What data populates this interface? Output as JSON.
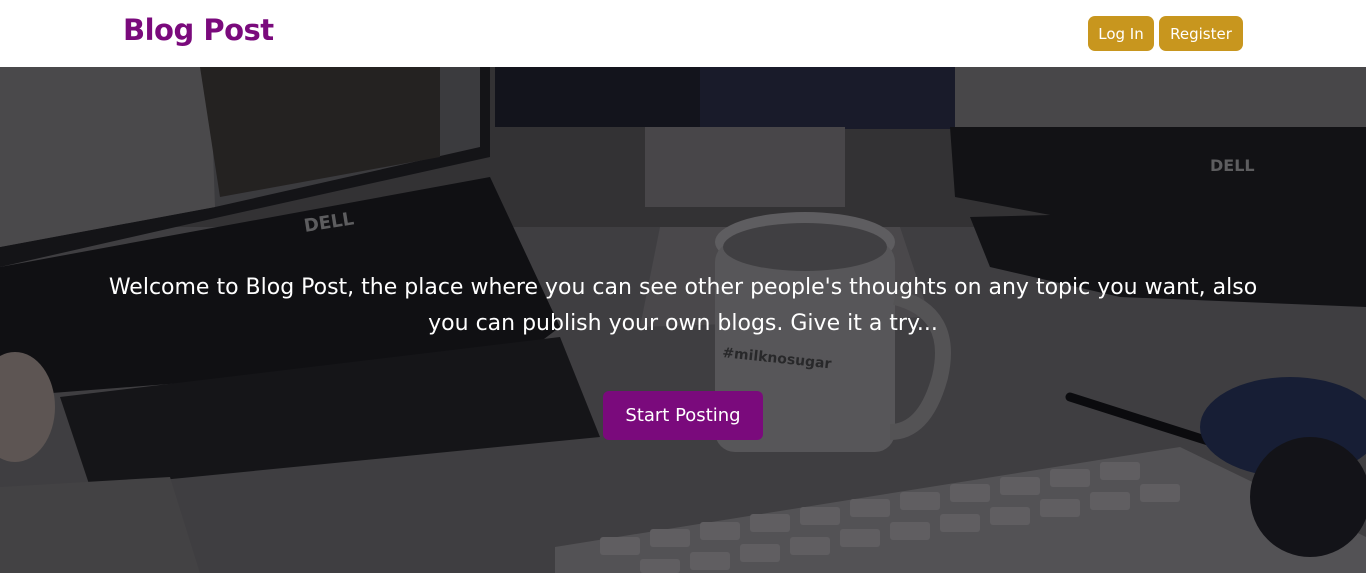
{
  "navbar": {
    "brand": "Blog Post",
    "login_label": "Log In",
    "register_label": "Register"
  },
  "hero": {
    "welcome_text": "Welcome to Blog Post, the place where you can see other people's thoughts on any topic you want, also you can publish your own blogs. Give it a try...",
    "cta_label": "Start Posting",
    "monitor_brand_left": "DELL",
    "monitor_brand_right": "DELL",
    "mug_text": "#milknosugar"
  },
  "colors": {
    "brand": "#7a0a7c",
    "nav_button": "#c8961e",
    "cta_button": "#7a0a7c"
  }
}
